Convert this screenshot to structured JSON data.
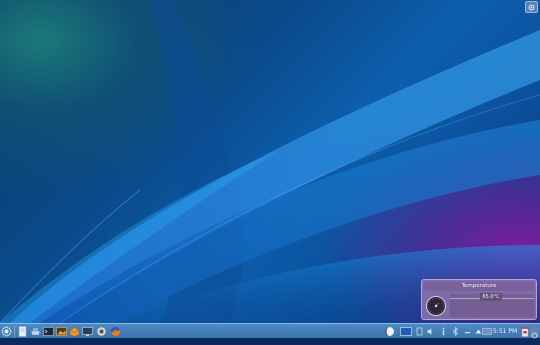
{
  "desktop": {
    "toolbox_icon": "cashew-icon"
  },
  "temperature_widget": {
    "title": "Temperature",
    "value": "65.0°C"
  },
  "taskbar": {
    "launchers": [
      {
        "name": "kickoff-application-launcher",
        "icon": "kde-gear-icon"
      },
      {
        "name": "file-manager",
        "icon": "file-icon"
      },
      {
        "name": "network-manager",
        "icon": "network-drive-icon"
      },
      {
        "name": "terminal",
        "icon": "terminal-icon"
      },
      {
        "name": "photo-viewer",
        "icon": "image-icon"
      },
      {
        "name": "package-manager",
        "icon": "package-icon"
      },
      {
        "name": "system-monitor",
        "icon": "monitor-icon"
      },
      {
        "name": "audio-player",
        "icon": "speaker-icon"
      },
      {
        "name": "firefox-browser",
        "icon": "firefox-icon"
      }
    ],
    "tray": [
      {
        "name": "weather",
        "icon": "moon-icon"
      },
      {
        "name": "desktop-pager",
        "icon": "desktop-icon"
      },
      {
        "name": "klipper",
        "icon": "clipboard-icon"
      },
      {
        "name": "volume",
        "icon": "volume-icon"
      },
      {
        "name": "notifications",
        "icon": "info-icon"
      },
      {
        "name": "bluetooth",
        "icon": "bluetooth-icon"
      },
      {
        "name": "battery",
        "icon": "battery-icon"
      },
      {
        "name": "show-hidden-icons",
        "icon": "arrow-up-icon"
      },
      {
        "name": "keyboard-layout",
        "icon": "keyboard-icon"
      }
    ],
    "clock": "5:51 PM",
    "trash_icon": "trash-icon"
  }
}
